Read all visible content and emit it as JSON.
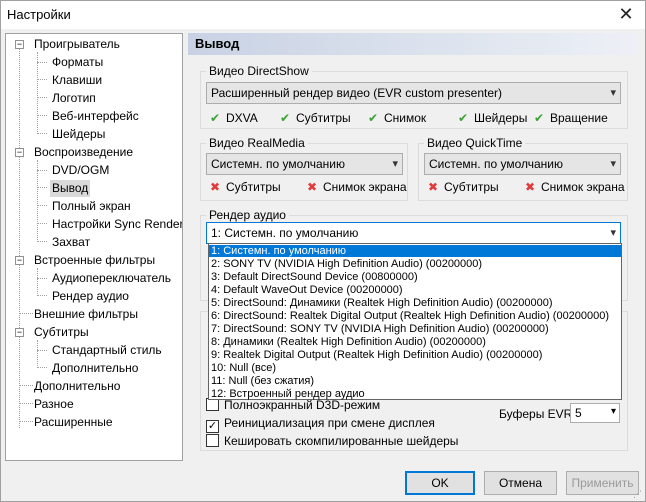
{
  "window": {
    "title": "Настройки",
    "close_glyph": "✕"
  },
  "tree": {
    "items": [
      {
        "label": "Проигрыватель",
        "expander": "−"
      },
      {
        "label": "Форматы"
      },
      {
        "label": "Клавиши"
      },
      {
        "label": "Логотип"
      },
      {
        "label": "Веб-интерфейс"
      },
      {
        "label": "Шейдеры"
      },
      {
        "label": "Воспроизведение",
        "expander": "−"
      },
      {
        "label": "DVD/OGM"
      },
      {
        "label": "Вывод",
        "selected": true
      },
      {
        "label": "Полный экран"
      },
      {
        "label": "Настройки Sync Render"
      },
      {
        "label": "Захват"
      },
      {
        "label": "Встроенные фильтры",
        "expander": "−"
      },
      {
        "label": "Аудиопереключатель"
      },
      {
        "label": "Рендер аудио"
      },
      {
        "label": "Внешние фильтры"
      },
      {
        "label": "Субтитры",
        "expander": "−"
      },
      {
        "label": "Стандартный стиль"
      },
      {
        "label": "Дополнительно"
      },
      {
        "label": "Дополнительно"
      },
      {
        "label": "Разное"
      },
      {
        "label": "Расширенные"
      }
    ]
  },
  "page": {
    "header": "Вывод",
    "directshow": {
      "title": "Видео DirectShow",
      "value": "Расширенный рендер видео (EVR custom presenter)",
      "features": [
        {
          "label": "DXVA",
          "status": "ok"
        },
        {
          "label": "Субтитры",
          "status": "ok"
        },
        {
          "label": "Снимок",
          "status": "ok"
        },
        {
          "label": "Шейдеры",
          "status": "ok"
        },
        {
          "label": "Вращение",
          "status": "ok"
        }
      ]
    },
    "realmedia": {
      "title": "Видео RealMedia",
      "value": "Системн. по умолчанию",
      "features": [
        {
          "label": "Субтитры",
          "status": "bad"
        },
        {
          "label": "Снимок экрана",
          "status": "bad"
        }
      ]
    },
    "quicktime": {
      "title": "Видео QuickTime",
      "value": "Системн. по умолчанию",
      "features": [
        {
          "label": "Субтитры",
          "status": "bad"
        },
        {
          "label": "Снимок экрана",
          "status": "bad"
        }
      ]
    },
    "audio": {
      "title": "Рендер аудио",
      "value": "1: Системн. по умолчанию",
      "options": [
        "1: Системн. по умолчанию",
        "2: SONY TV (NVIDIA High Definition Audio) (00200000)",
        "3: Default DirectSound Device (00800000)",
        "4: Default WaveOut Device (00200000)",
        "5: DirectSound: Динамики (Realtek High Definition Audio) (00200000)",
        "6: DirectSound: Realtek Digital Output (Realtek High Definition Audio) (00200000)",
        "7: DirectSound: SONY TV (NVIDIA High Definition Audio) (00200000)",
        "8: Динамики (Realtek High Definition Audio) (00200000)",
        "9: Realtek Digital Output (Realtek High Definition Audio) (00200000)",
        "10: Null (все)",
        "11: Null (без сжатия)",
        "12: Встроенный рендер аудио"
      ]
    },
    "options": {
      "fullscreen_d3d": "Полноэкранный D3D-режим",
      "reinit": "Реинициализация при смене дисплея",
      "cache_shaders": "Кешировать скомпилированные шейдеры",
      "evr_buffers_label": "Буферы EVR:",
      "evr_buffers_value": "5"
    }
  },
  "buttons": {
    "ok": "OK",
    "cancel": "Отмена",
    "apply": "Применить"
  },
  "icons": {
    "ok": "✔",
    "bad": "✖",
    "dropdown": "▾",
    "check": "✓"
  },
  "colors": {
    "ok": "#3aa234",
    "bad": "#e03c3c",
    "accent": "#0078d7"
  }
}
